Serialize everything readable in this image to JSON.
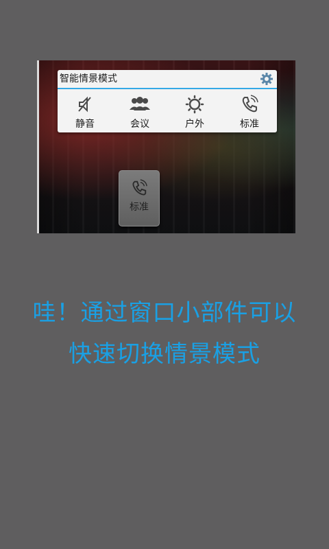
{
  "widget": {
    "title": "智能情景模式",
    "modes": [
      {
        "label": "静音",
        "icon": "mute-icon"
      },
      {
        "label": "会议",
        "icon": "meeting-icon"
      },
      {
        "label": "户外",
        "icon": "outdoor-icon"
      },
      {
        "label": "标准",
        "icon": "phone-icon"
      }
    ]
  },
  "floating_button": {
    "label": "标准",
    "icon": "phone-icon"
  },
  "promo": {
    "line1": "哇！通过窗口小部件可以",
    "line2": "快速切换情景模式"
  },
  "colors": {
    "background": "#5f5e5f",
    "accent": "#1aa0e4",
    "widget_bg": "#f3f3f3",
    "widget_underline": "#33a8e6"
  }
}
